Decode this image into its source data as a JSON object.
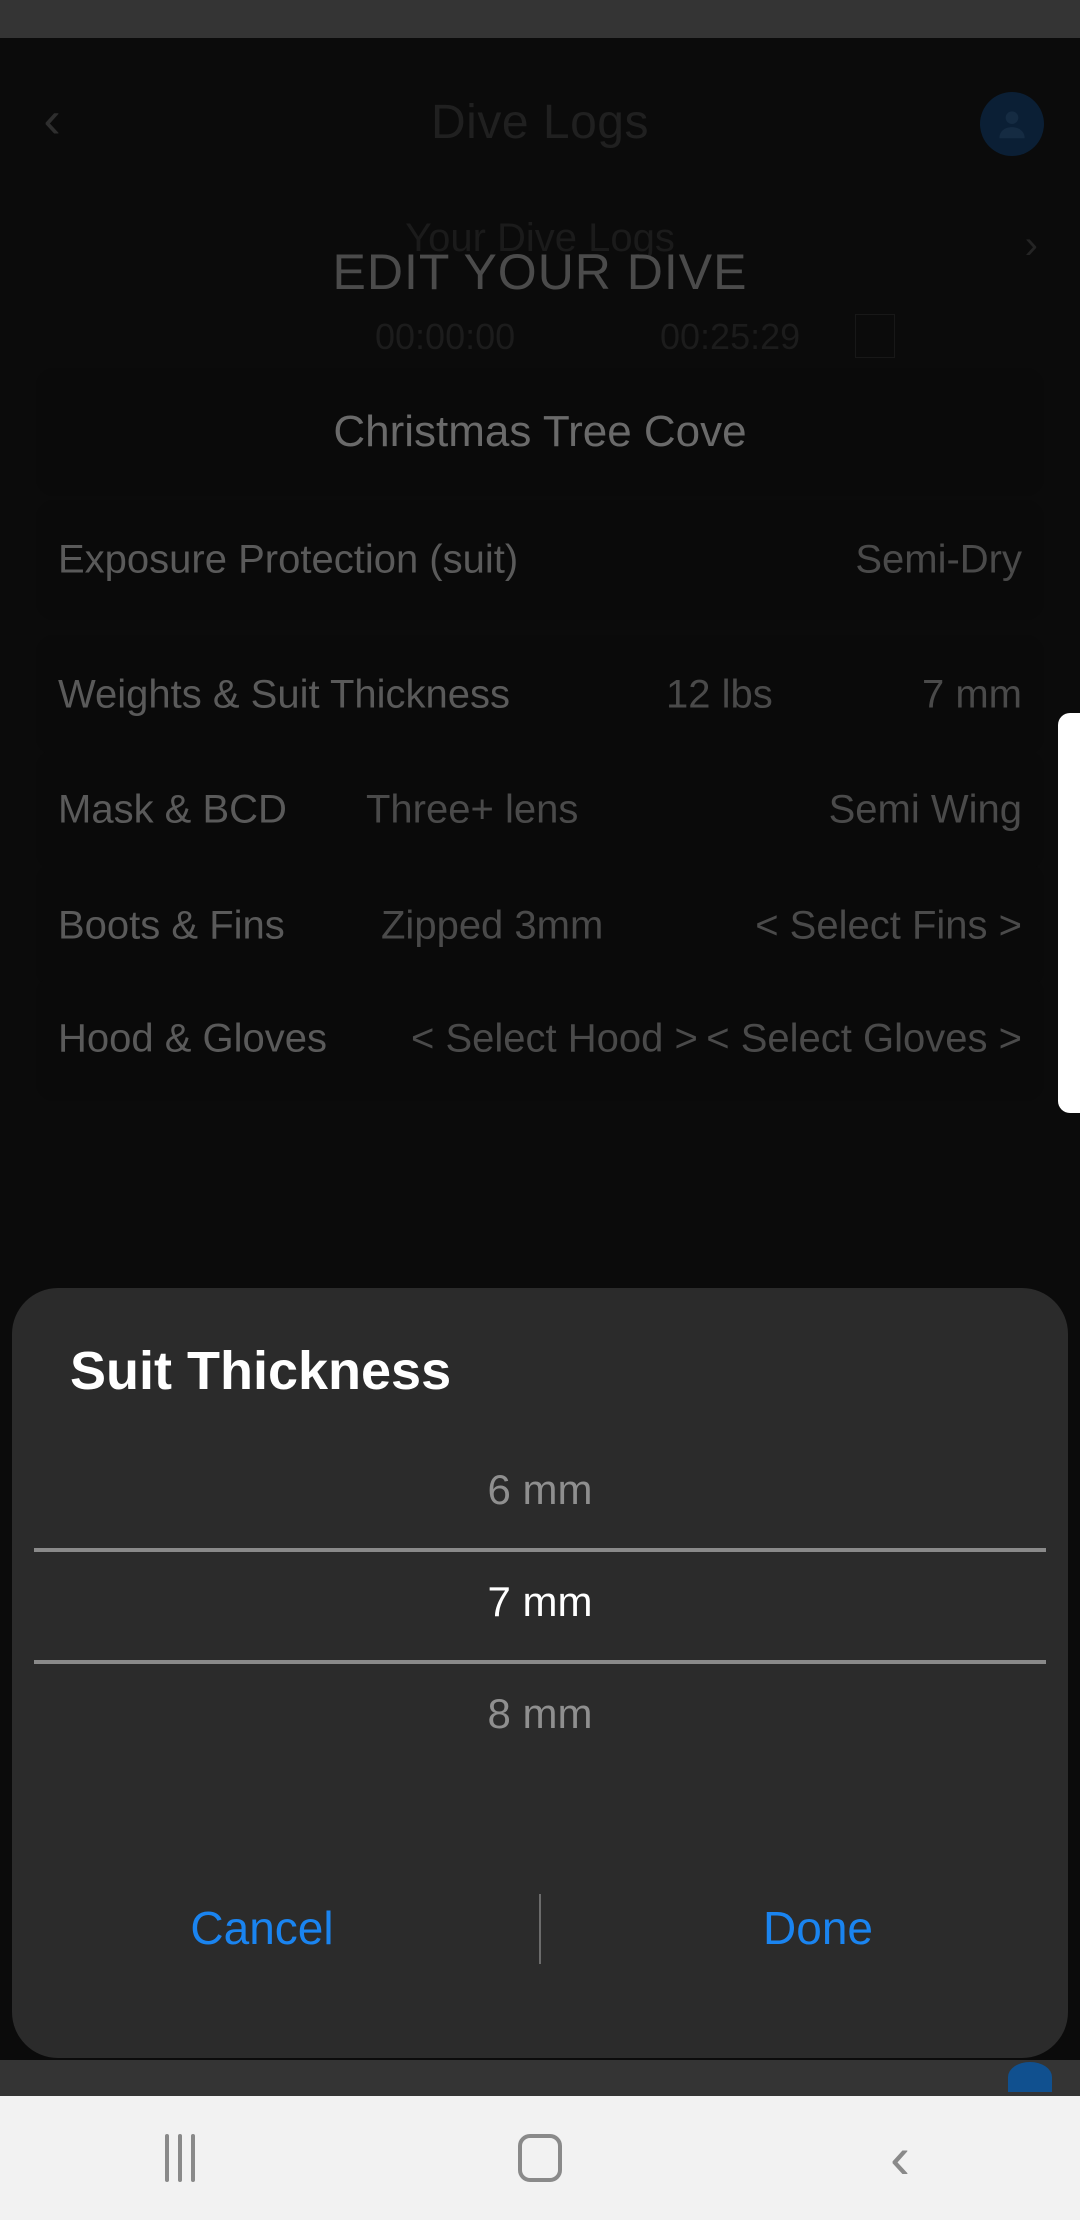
{
  "app": {
    "nav_title": "Dive Logs",
    "back_icon": "chevron-left-icon",
    "avatar_icon": "user-avatar-icon",
    "sub_title": "Your Dive Logs",
    "next_icon": "chevron-right-icon",
    "section_title": "EDIT YOUR DIVE",
    "time_start": "00:00:00",
    "time_elapsed": "00:25:29"
  },
  "dive": {
    "site_name": "Christmas Tree Cove",
    "rows": [
      {
        "label": "Exposure Protection (suit)",
        "mid": "",
        "right": "Semi-Dry"
      },
      {
        "label": "Weights & Suit Thickness",
        "mid": "12 lbs",
        "right": "7 mm"
      },
      {
        "label": "Mask & BCD",
        "mid": "Three+ lens",
        "right": "Semi Wing"
      },
      {
        "label": "Boots & Fins",
        "mid": "Zipped 3mm",
        "right": "< Select Fins >"
      },
      {
        "label": "Hood & Gloves",
        "mid": "< Select Hood >",
        "right": "< Select Gloves >"
      }
    ]
  },
  "modal": {
    "title": "Suit Thickness",
    "picker": {
      "previous": "6 mm",
      "selected": "7 mm",
      "next": "8 mm",
      "options": [
        "6 mm",
        "7 mm",
        "8 mm"
      ]
    },
    "cancel_label": "Cancel",
    "done_label": "Done"
  },
  "system_nav": {
    "recents_icon": "recents-icon",
    "home_icon": "home-icon",
    "back_icon": "back-icon"
  },
  "colors": {
    "accent_blue": "#1a84f0",
    "modal_bg": "#2b2b2b",
    "app_bg": "#0b0b0b",
    "navbar_bg": "#f2f2f2"
  }
}
